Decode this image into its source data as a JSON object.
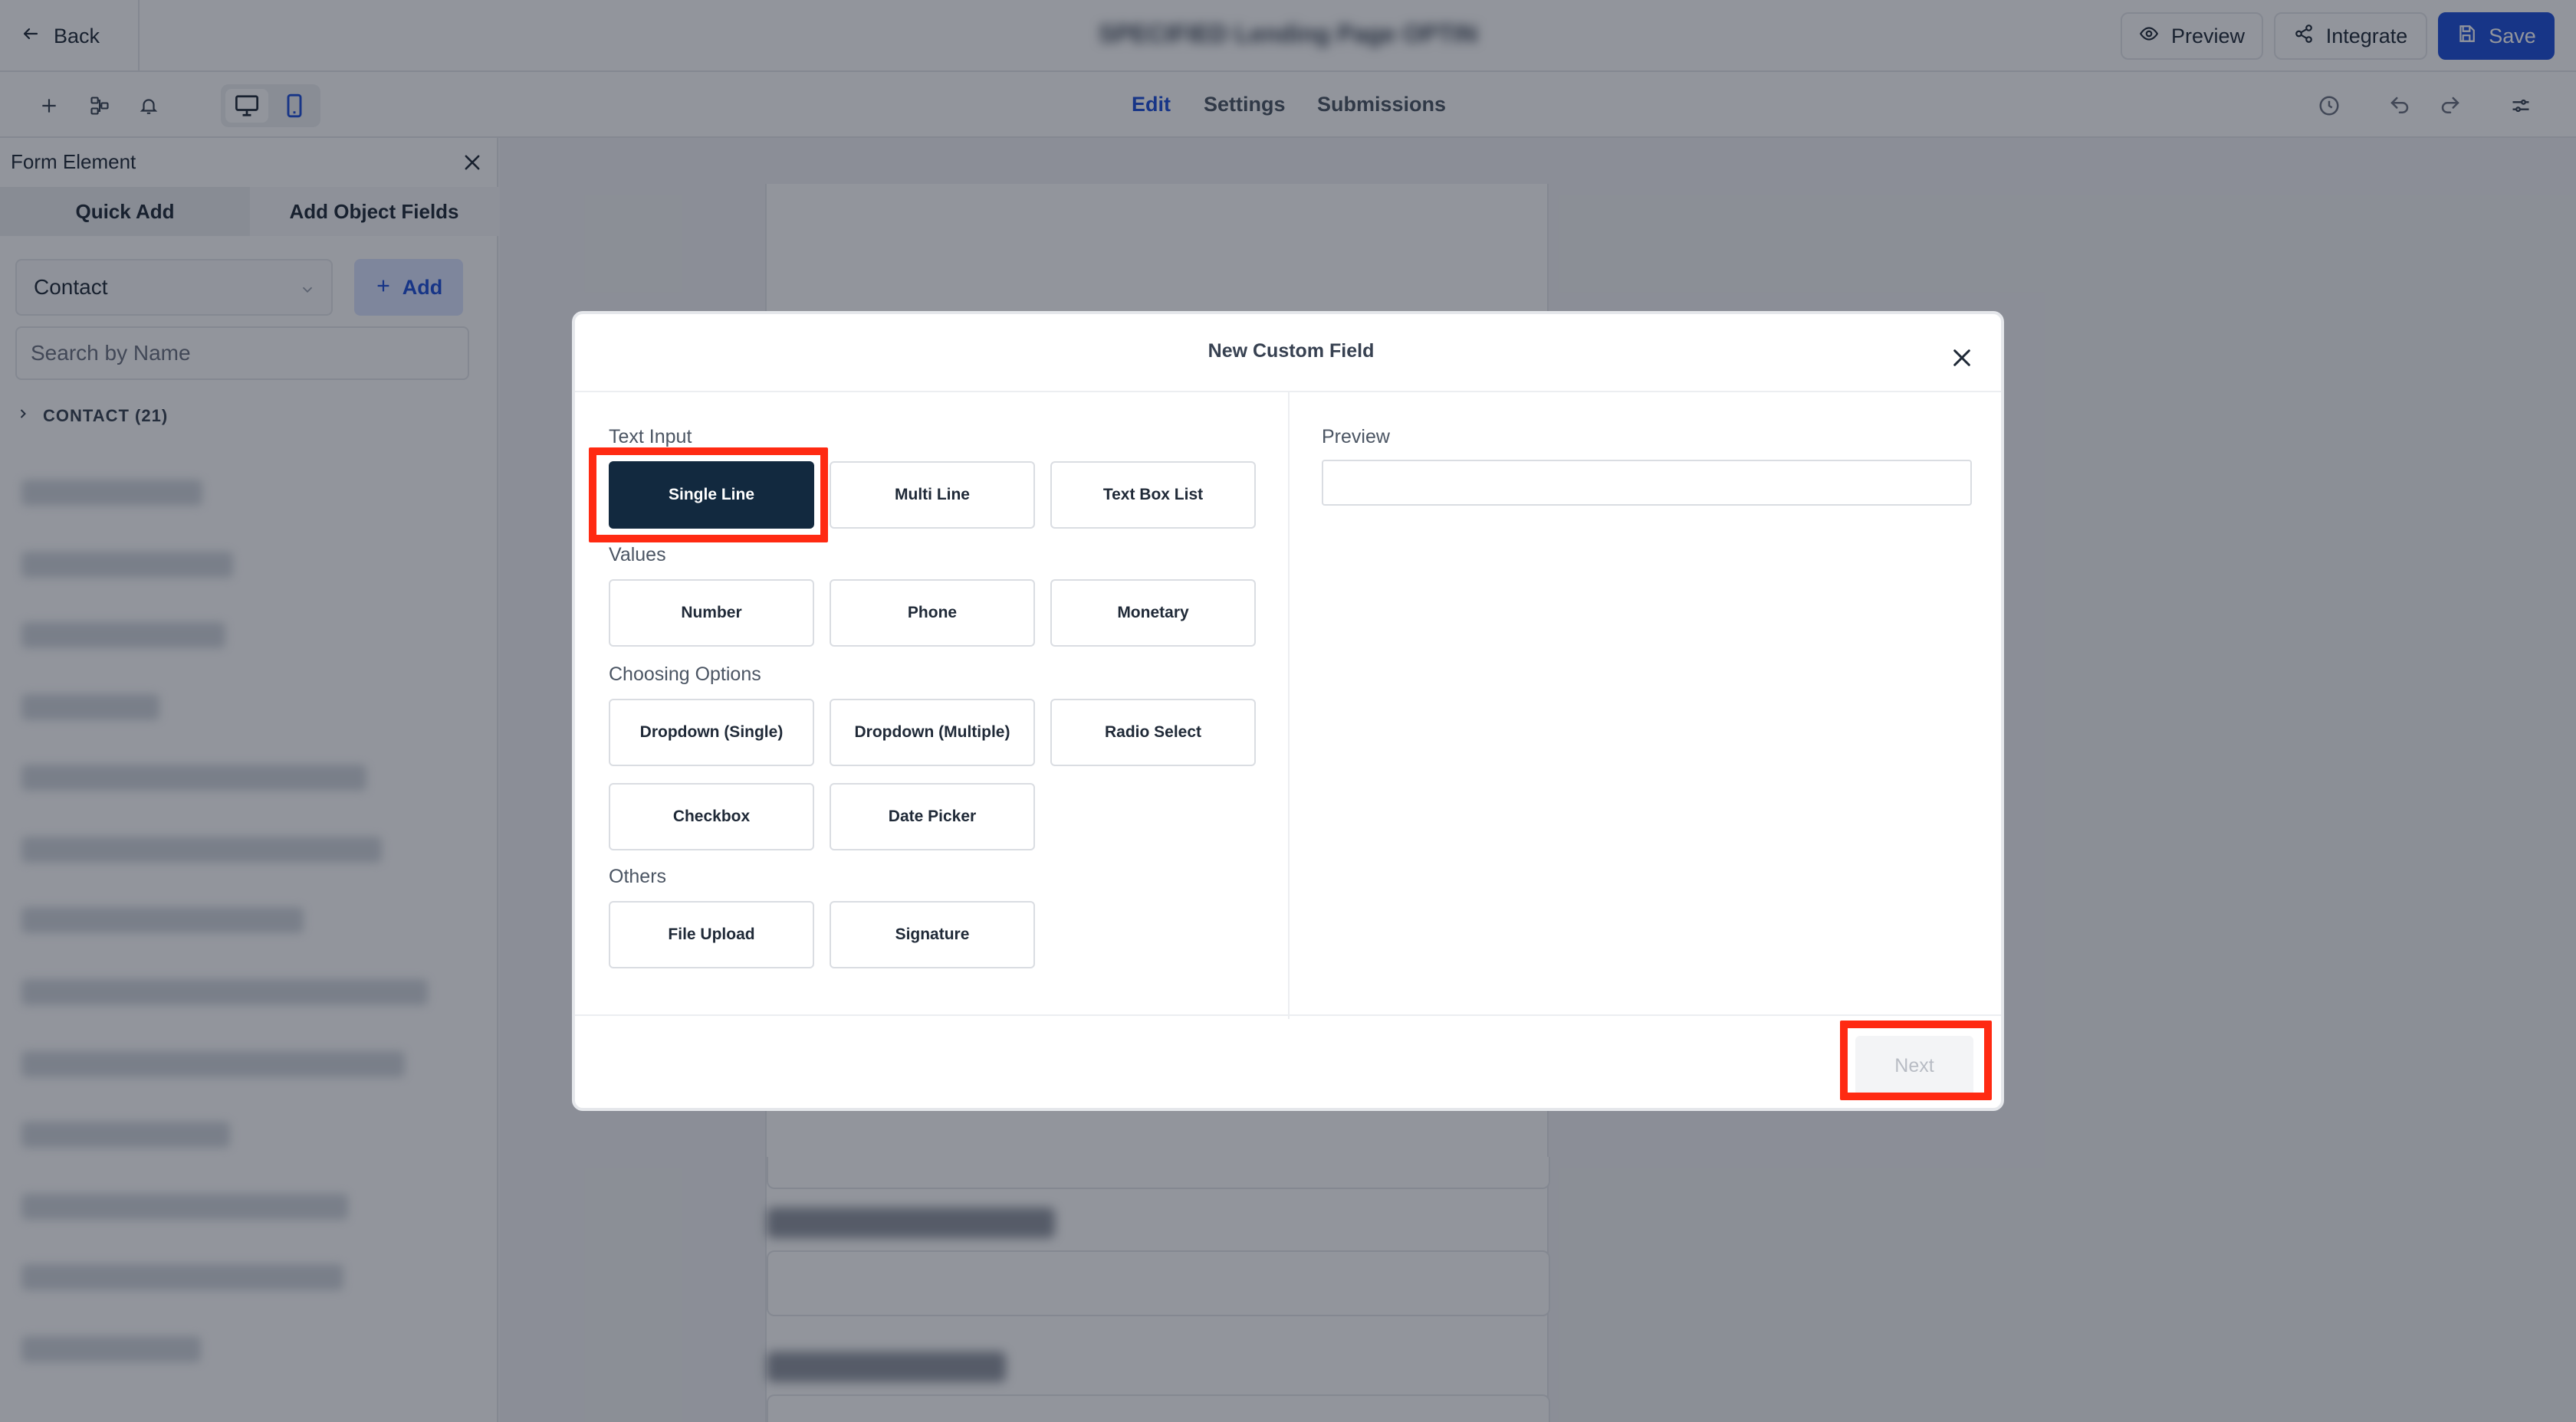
{
  "topbar": {
    "back_label": "Back",
    "form_title": "SPECIFIED Lending Page OPTIN",
    "preview_label": "Preview",
    "integrate_label": "Integrate",
    "save_label": "Save",
    "accent_color": "#1d4ed8"
  },
  "toolbar": {
    "tabs": [
      {
        "label": "Edit",
        "active": true
      },
      {
        "label": "Settings",
        "active": false
      },
      {
        "label": "Submissions",
        "active": false
      }
    ],
    "left_icons": [
      "plus-icon",
      "layers-icon",
      "bell-icon"
    ],
    "device_icons": [
      "desktop-icon",
      "mobile-icon"
    ],
    "right_icons": [
      "history-icon",
      "undo-icon",
      "redo-icon",
      "sliders-icon"
    ]
  },
  "left_panel": {
    "title": "Form Element",
    "tabs": [
      "Quick Add",
      "Add Object Fields"
    ],
    "object_select": "Contact",
    "add_label": "Add",
    "search_placeholder": "Search by Name",
    "group_label": "CONTACT (21)"
  },
  "modal": {
    "title": "New Custom Field",
    "sections": [
      {
        "label": "Text Input",
        "options": [
          "Single Line",
          "Multi Line",
          "Text Box List"
        ]
      },
      {
        "label": "Values",
        "options": [
          "Number",
          "Phone",
          "Monetary"
        ]
      },
      {
        "label": "Choosing Options",
        "options": [
          "Dropdown (Single)",
          "Dropdown (Multiple)",
          "Radio Select",
          "Checkbox",
          "Date Picker"
        ]
      },
      {
        "label": "Others",
        "options": [
          "File Upload",
          "Signature"
        ]
      }
    ],
    "selected_option": "Single Line",
    "preview_label": "Preview",
    "next_label": "Next",
    "selected_color": "#12293f",
    "highlight_color": "#ff2a12"
  }
}
